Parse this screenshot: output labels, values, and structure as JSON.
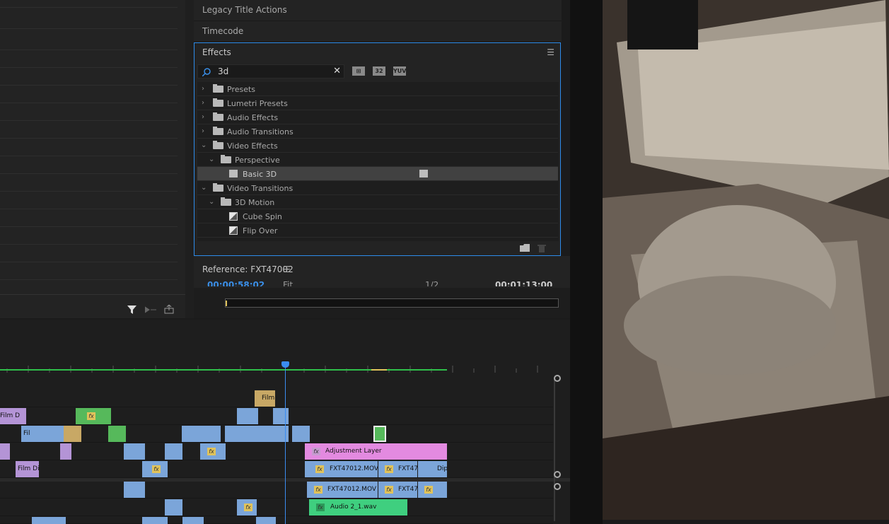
{
  "panels": {
    "legacy_title_actions": "Legacy Title Actions",
    "timecode": "Timecode"
  },
  "effects": {
    "title": "Effects",
    "menu_icon": "hamburger-icon",
    "search_value": "3d",
    "badges": [
      "accelerated-icon",
      "32",
      "YUV"
    ],
    "tree": [
      {
        "label": "Presets",
        "expanded": false,
        "depth": 0,
        "icon": "preset-folder-icon"
      },
      {
        "label": "Lumetri Presets",
        "expanded": false,
        "depth": 0,
        "icon": "preset-folder-icon"
      },
      {
        "label": "Audio Effects",
        "expanded": false,
        "depth": 0,
        "icon": "folder-icon"
      },
      {
        "label": "Audio Transitions",
        "expanded": false,
        "depth": 0,
        "icon": "folder-icon"
      },
      {
        "label": "Video Effects",
        "expanded": true,
        "depth": 0,
        "icon": "folder-icon"
      },
      {
        "label": "Perspective",
        "expanded": true,
        "depth": 1,
        "icon": "folder-icon"
      },
      {
        "label": "Basic 3D",
        "depth": 2,
        "icon": "effect-icon",
        "selected": true
      },
      {
        "label": "Video Transitions",
        "expanded": true,
        "depth": 0,
        "icon": "folder-icon"
      },
      {
        "label": "3D Motion",
        "expanded": true,
        "depth": 1,
        "icon": "folder-icon"
      },
      {
        "label": "Cube Spin",
        "depth": 2,
        "icon": "transition-icon"
      },
      {
        "label": "Flip Over",
        "depth": 2,
        "icon": "transition-icon"
      }
    ]
  },
  "reference": {
    "title": "Reference: FXT47002",
    "timecode_left": "00:00:58:02",
    "fit": "Fit",
    "ratio": "1/2",
    "timecode_right": "00:01:13:00"
  },
  "timeline": {
    "clips": {
      "film_a": "Film",
      "adjustment": "Adjustment Layer",
      "fxt_v1": "FXT47012.MOV",
      "fxt_v1b": "FXT47",
      "dip": "Dip",
      "film_di": "Film Di",
      "fxt_a1": "FXT47012.MOV [",
      "fxt_a1b": "FXT47",
      "audio": "Audio 2_1.wav",
      "fil": "Fil",
      "film_d": "Film D",
      "fx": "fx"
    }
  },
  "colors": {
    "accent": "#2d8ceb",
    "adjustment": "#e38ae0",
    "video_clip": "#7ba5d9",
    "audio_clip": "#3fcf7f",
    "transition": "#c8a865",
    "green_clip": "#56b95b",
    "purple_clip": "#b494d6"
  }
}
